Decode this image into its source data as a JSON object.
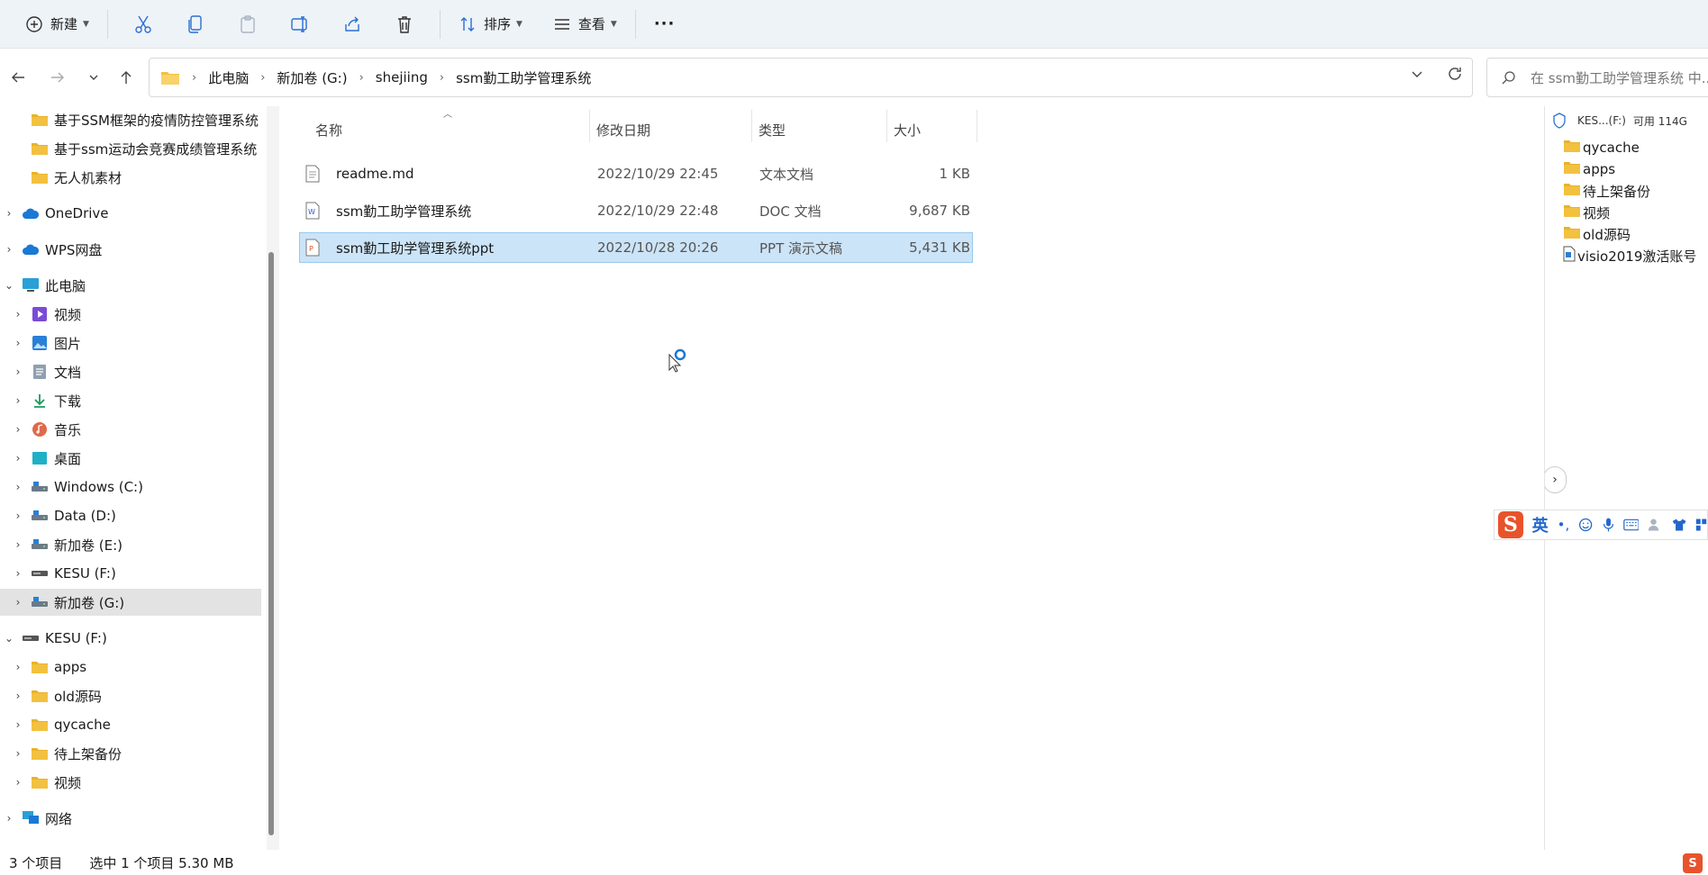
{
  "toolbar": {
    "new_label": "新建",
    "sort_label": "排序",
    "view_label": "查看",
    "more_label": "···"
  },
  "address": {
    "crumbs": [
      "此电脑",
      "新加卷 (G:)",
      "shejiing",
      "ssm勤工助学管理系统"
    ]
  },
  "search": {
    "placeholder": "在 ssm勤工助学管理系统 中..."
  },
  "sidebar": {
    "items": [
      {
        "label": "基于SSM框架的疫情防控管理系统",
        "icon": "folder-icon"
      },
      {
        "label": "基于ssm运动会竞赛成绩管理系统",
        "icon": "folder-icon"
      },
      {
        "label": "无人机素材",
        "icon": "folder-icon"
      },
      {
        "label": "OneDrive",
        "icon": "cloud-icon"
      },
      {
        "label": "WPS网盘",
        "icon": "cloud-icon"
      },
      {
        "label": "此电脑",
        "icon": "computer-icon"
      },
      {
        "label": "视频",
        "icon": "video-icon"
      },
      {
        "label": "图片",
        "icon": "picture-icon"
      },
      {
        "label": "文档",
        "icon": "document-icon"
      },
      {
        "label": "下载",
        "icon": "download-icon"
      },
      {
        "label": "音乐",
        "icon": "music-icon"
      },
      {
        "label": "桌面",
        "icon": "desktop-icon"
      },
      {
        "label": "Windows (C:)",
        "icon": "drive-icon"
      },
      {
        "label": "Data (D:)",
        "icon": "drive-icon"
      },
      {
        "label": "新加卷 (E:)",
        "icon": "drive-icon"
      },
      {
        "label": "KESU  (F:)",
        "icon": "usb-drive-icon"
      },
      {
        "label": "新加卷 (G:)",
        "icon": "drive-icon"
      },
      {
        "label": "KESU  (F:)",
        "icon": "usb-drive-icon"
      },
      {
        "label": "apps",
        "icon": "folder-icon"
      },
      {
        "label": "old源码",
        "icon": "folder-icon"
      },
      {
        "label": "qycache",
        "icon": "folder-icon"
      },
      {
        "label": "待上架备份",
        "icon": "folder-icon"
      },
      {
        "label": "视频",
        "icon": "folder-icon"
      },
      {
        "label": "网络",
        "icon": "network-icon"
      }
    ]
  },
  "columns": {
    "name": "名称",
    "modified": "修改日期",
    "type": "类型",
    "size": "大小"
  },
  "files": [
    {
      "name": "readme.md",
      "modified": "2022/10/29 22:45",
      "type": "文本文档",
      "size": "1 KB",
      "icon": "text-file-icon"
    },
    {
      "name": "ssm勤工助学管理系统",
      "modified": "2022/10/29 22:48",
      "type": "DOC 文档",
      "size": "9,687 KB",
      "icon": "word-file-icon"
    },
    {
      "name": "ssm勤工助学管理系统ppt",
      "modified": "2022/10/28 20:26",
      "type": "PPT 演示文稿",
      "size": "5,431 KB",
      "icon": "ppt-file-icon"
    }
  ],
  "preview": {
    "drive_label": "KES...(F:)",
    "free_label": "可用 114G",
    "items": [
      {
        "label": "qycache",
        "icon": "folder-icon"
      },
      {
        "label": "apps",
        "icon": "folder-icon"
      },
      {
        "label": "待上架备份",
        "icon": "folder-icon"
      },
      {
        "label": "视频",
        "icon": "folder-icon"
      },
      {
        "label": "old源码",
        "icon": "folder-icon"
      },
      {
        "label": "visio2019激活账号",
        "icon": "file-icon"
      }
    ]
  },
  "ime": {
    "lang": "英",
    "logo": "S"
  },
  "status": {
    "count": "3 个项目",
    "selection": "选中 1 个项目  5.30 MB"
  },
  "colors": {
    "folder": "#f3c140",
    "selected_row": "#cce4f7",
    "selected_border": "#99c9ef",
    "toolbar_bg": "#eef3f8",
    "ime_brand": "#e8532b"
  }
}
